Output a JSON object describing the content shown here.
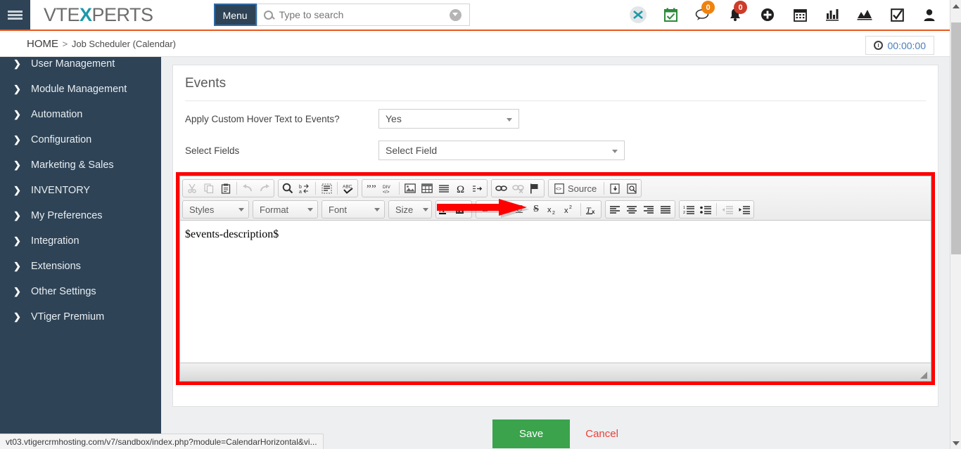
{
  "header": {
    "hamburger_icon": "hamburger-menu-icon",
    "brand_part1": "VTE",
    "brand_x": "X",
    "brand_part2": "PERTS",
    "menu_label": "Menu",
    "search_placeholder": "Type to search",
    "search_value": "",
    "icons": [
      {
        "name": "xing-share-icon",
        "glyph": "X",
        "badge": null
      },
      {
        "name": "calendar-check-icon",
        "glyph": "",
        "badge": null
      },
      {
        "name": "chat-bubble-icon",
        "glyph": "",
        "badge": "0",
        "badge_color": "#f0820e"
      },
      {
        "name": "notification-bell-icon",
        "glyph": "",
        "badge": "0",
        "badge_color": "#cd3c2a"
      },
      {
        "name": "add-circle-icon",
        "glyph": "",
        "badge": null
      },
      {
        "name": "calendar-grid-icon",
        "glyph": "",
        "badge": null
      },
      {
        "name": "bar-chart-icon",
        "glyph": "",
        "badge": null
      },
      {
        "name": "area-chart-icon",
        "glyph": "",
        "badge": null
      },
      {
        "name": "checkbox-task-icon",
        "glyph": "",
        "badge": null
      },
      {
        "name": "user-profile-icon",
        "glyph": "",
        "badge": null
      }
    ]
  },
  "breadcrumb": {
    "home": "HOME",
    "separator": ">",
    "current": "Job Scheduler (Calendar)"
  },
  "timer": {
    "icon": "clock-icon",
    "value": "00:00:00"
  },
  "sidebar": {
    "items": [
      {
        "label": "User Management"
      },
      {
        "label": "Module Management"
      },
      {
        "label": "Automation"
      },
      {
        "label": "Configuration"
      },
      {
        "label": "Marketing & Sales"
      },
      {
        "label": "INVENTORY"
      },
      {
        "label": "My Preferences"
      },
      {
        "label": "Integration"
      },
      {
        "label": "Extensions"
      },
      {
        "label": "Other Settings"
      },
      {
        "label": "VTiger Premium"
      }
    ]
  },
  "panel": {
    "title": "Events",
    "fields": [
      {
        "label": "Apply Custom Hover Text to Events?",
        "control": "select",
        "value": "Yes"
      },
      {
        "label": "Select Fields",
        "control": "select",
        "value": "Select Field"
      }
    ]
  },
  "annotation": {
    "arrow_color": "#fe0000",
    "highlight_color": "#fe0000"
  },
  "editor": {
    "content": "$events-description$",
    "toolbar_row1": [
      {
        "name": "cut-icon",
        "label": "Cut",
        "disabled": true
      },
      {
        "name": "copy-icon",
        "label": "Copy",
        "disabled": true
      },
      {
        "name": "paste-icon",
        "label": "Paste",
        "disabled": false
      },
      {
        "name": "undo-icon",
        "label": "Undo",
        "disabled": true
      },
      {
        "name": "redo-icon",
        "label": "Redo",
        "disabled": true
      },
      {
        "name": "find-icon",
        "label": "Find",
        "disabled": false
      },
      {
        "name": "replace-icon",
        "label": "Replace",
        "disabled": false
      },
      {
        "name": "select-all-icon",
        "label": "Select All",
        "disabled": false
      },
      {
        "name": "spellcheck-icon",
        "label": "Spell Check As You Type",
        "disabled": false
      },
      {
        "name": "blockquote-icon",
        "label": "Block Quote",
        "disabled": false
      },
      {
        "name": "create-div-icon",
        "label": "Create Div Container",
        "disabled": false
      },
      {
        "name": "image-icon",
        "label": "Image",
        "disabled": false
      },
      {
        "name": "table-icon",
        "label": "Table",
        "disabled": false
      },
      {
        "name": "horizontal-rule-icon",
        "label": "Horizontal Line",
        "disabled": false
      },
      {
        "name": "special-character-icon",
        "label": "Insert Special Character",
        "disabled": false
      },
      {
        "name": "page-break-icon",
        "label": "Page Break",
        "disabled": false
      },
      {
        "name": "link-icon",
        "label": "Link",
        "disabled": false
      },
      {
        "name": "unlink-icon",
        "label": "Unlink",
        "disabled": true
      },
      {
        "name": "anchor-flag-icon",
        "label": "Anchor",
        "disabled": false
      },
      {
        "name": "source-icon",
        "label": "Source",
        "disabled": false
      },
      {
        "name": "templates-icon",
        "label": "Templates",
        "disabled": false
      },
      {
        "name": "preview-icon",
        "label": "Preview",
        "disabled": false
      }
    ],
    "source_label": "Source",
    "combos": [
      {
        "name": "styles-combo",
        "label": "Styles"
      },
      {
        "name": "format-combo",
        "label": "Format"
      },
      {
        "name": "font-combo",
        "label": "Font"
      },
      {
        "name": "size-combo",
        "label": "Size"
      }
    ],
    "toolbar_row2": [
      {
        "name": "text-color-icon",
        "label": "Text Color"
      },
      {
        "name": "background-color-icon",
        "label": "Background Color"
      },
      {
        "name": "bold-icon",
        "label": "Bold"
      },
      {
        "name": "italic-icon",
        "label": "Italic"
      },
      {
        "name": "underline-icon",
        "label": "Underline"
      },
      {
        "name": "strikethrough-icon",
        "label": "Strike Through"
      },
      {
        "name": "subscript-icon",
        "label": "Subscript"
      },
      {
        "name": "superscript-icon",
        "label": "Superscript"
      },
      {
        "name": "remove-format-icon",
        "label": "Remove Format"
      },
      {
        "name": "align-left-icon",
        "label": "Align Left"
      },
      {
        "name": "align-center-icon",
        "label": "Center"
      },
      {
        "name": "align-right-icon",
        "label": "Align Right"
      },
      {
        "name": "justify-icon",
        "label": "Justify"
      },
      {
        "name": "numbered-list-icon",
        "label": "Insert/Remove Numbered List"
      },
      {
        "name": "bulleted-list-icon",
        "label": "Insert/Remove Bulleted List"
      },
      {
        "name": "outdent-icon",
        "label": "Decrease Indent"
      },
      {
        "name": "indent-icon",
        "label": "Increase Indent"
      }
    ],
    "resize_grip": "resize-grip-icon"
  },
  "footer": {
    "save_label": "Save",
    "cancel_label": "Cancel",
    "save_color": "#3aa34c",
    "cancel_color": "#e8413a"
  },
  "browser": {
    "status_url": "vt03.vtigercrmhosting.com/v7/sandbox/index.php?module=CalendarHorizontal&vi..."
  }
}
